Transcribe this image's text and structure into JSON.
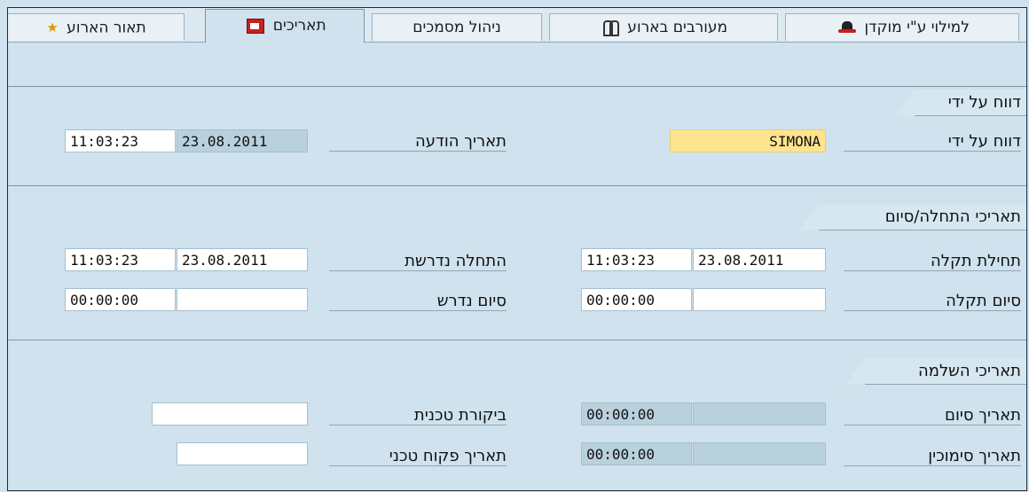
{
  "tabs": [
    {
      "label": "תאור הארוע",
      "icon": "star-icon"
    },
    {
      "label": "תאריכים",
      "icon": "calendar-icon"
    },
    {
      "label": "ניהול מסמכים",
      "icon": ""
    },
    {
      "label": "מעורבים בארוע",
      "icon": "people-icon"
    },
    {
      "label": "למילוי ע\"י מוקדן",
      "icon": "hat-icon"
    }
  ],
  "reported_by": {
    "title": "דווח על ידי",
    "reported_by_label": "דווח על ידי",
    "reported_by_value": "SIMONA",
    "notice_date_label": "תאריך הודעה",
    "notice_date": "23.08.2011",
    "notice_time": "11:03:23"
  },
  "start_end": {
    "title": "תאריכי התחלה/סיום",
    "fault_start_label": "תחילת תקלה",
    "fault_start_date": "23.08.2011",
    "fault_start_time": "11:03:23",
    "fault_end_label": "סיום תקלה",
    "fault_end_date": "",
    "fault_end_time": "00:00:00",
    "required_start_label": "התחלה נדרשת",
    "required_start_date": "23.08.2011",
    "required_start_time": "11:03:23",
    "required_end_label": "סיום נדרש",
    "required_end_date": "",
    "required_end_time": "00:00:00"
  },
  "completion": {
    "title": "תאריכי השלמה",
    "end_date_label": "תאריך סיום",
    "end_date": "",
    "end_time": "00:00:00",
    "signoff_date_label": "תאריך סימוכין",
    "signoff_date": "",
    "signoff_time": "00:00:00",
    "tech_review_label": "ביקורת טכנית",
    "tech_review_value": "",
    "tech_inspector_label": "תאריך פקוח טכני",
    "tech_inspector_value": ""
  }
}
